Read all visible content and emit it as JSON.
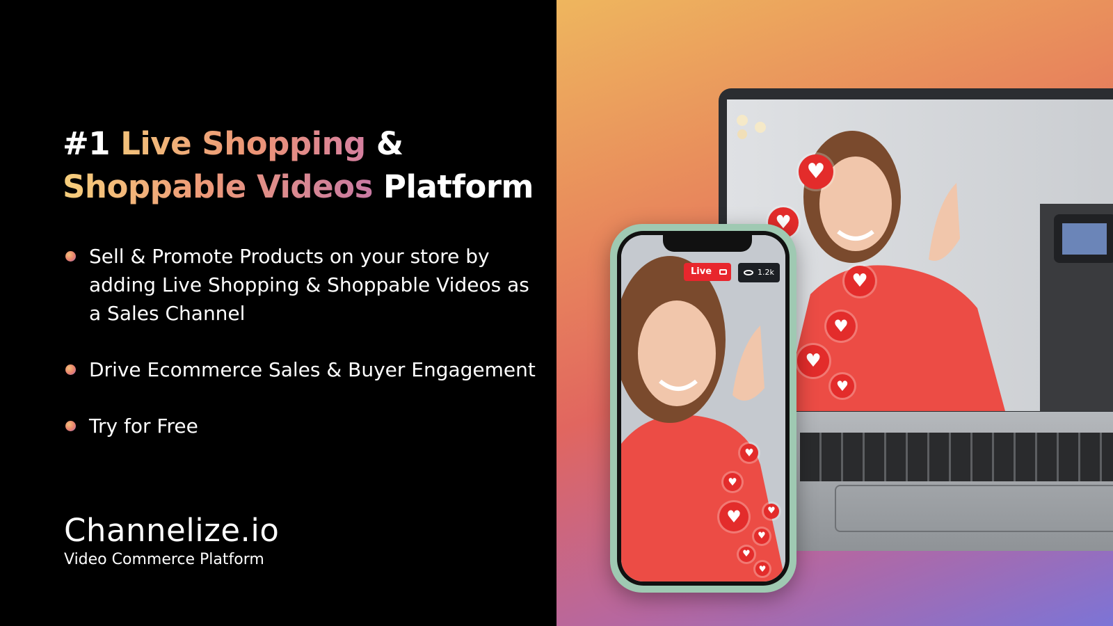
{
  "headline": {
    "line1_a": "#1 ",
    "line1_b": "Live Shopping",
    "line1_c": " &",
    "line2_a": "Shoppable Videos",
    "line2_b": " Platform"
  },
  "bullets": [
    "Sell & Promote Products on your store by adding Live Shopping & Shoppable Videos as a Sales Channel",
    "Drive Ecommerce Sales & Buyer Engagement",
    "Try for Free"
  ],
  "logo": {
    "word": "Channelize.io",
    "tagline": "Video Commerce Platform"
  },
  "phone": {
    "live_label": "Live",
    "viewer_count": "1.2k"
  },
  "colors": {
    "live_red": "#e8262d",
    "heart_red": "#e32c2b",
    "phone_frame": "#9fc9b2"
  }
}
